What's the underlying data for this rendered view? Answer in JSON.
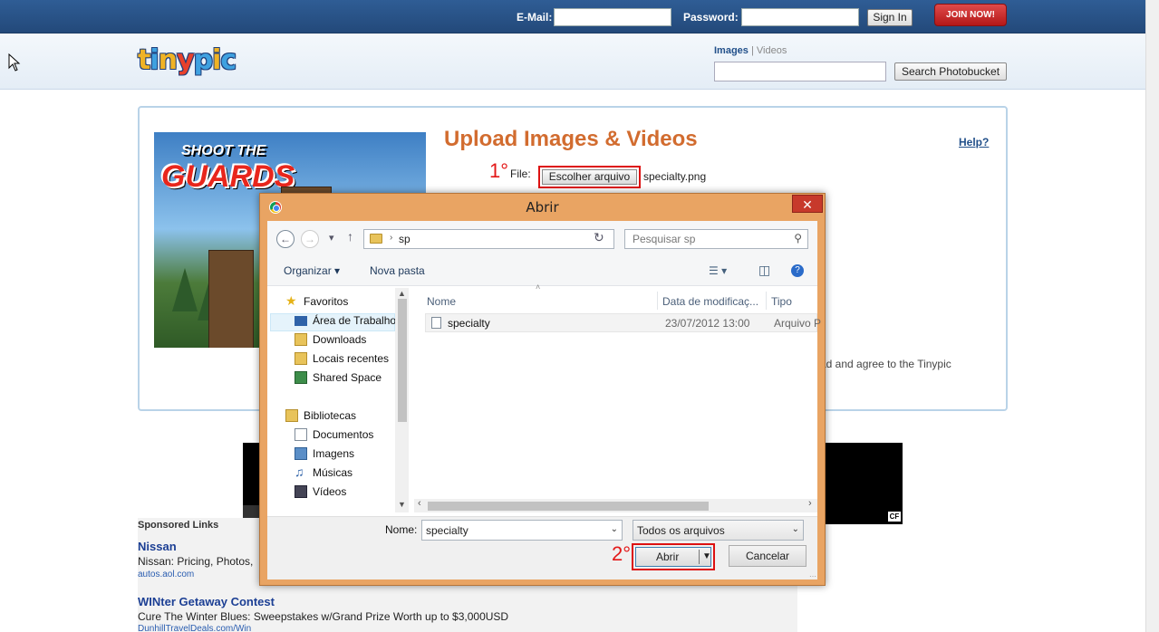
{
  "topbar": {
    "email_label": "E-Mail:",
    "password_label": "Password:",
    "signin_label": "Sign In",
    "join_label": "JOIN NOW!"
  },
  "header": {
    "logo_letters": [
      "t",
      "i",
      "n",
      "y",
      "p",
      "i",
      "c"
    ],
    "logo_colors": [
      "#f0b325",
      "#3fa1e0",
      "#f0b325",
      "#e8412b",
      "#3fa1e0",
      "#f0b325",
      "#3fa1e0"
    ],
    "search_tabs": {
      "images": "Images",
      "separator": "|",
      "videos": "Videos"
    },
    "search_button": "Search Photobucket"
  },
  "game_ad": {
    "line1": "SHOOT THE",
    "line2": "GUARDS"
  },
  "upload": {
    "title": "Upload Images & Videos",
    "help": "Help?",
    "step1": "1°",
    "file_label": "File:",
    "choose_button": "Escolher arquivo",
    "file_name": "specialty.png",
    "terms_partial": "ad and agree to the Tinypic"
  },
  "dialog": {
    "title": "Abrir",
    "close": "✕",
    "path_folder": "sp",
    "search_placeholder": "Pesquisar sp",
    "organize": "Organizar ▾",
    "new_folder": "Nova pasta",
    "nav": {
      "favorites": "Favoritos",
      "desktop": "Área de Trabalho",
      "downloads": "Downloads",
      "recent": "Locais recentes",
      "shared": "Shared Space",
      "libraries": "Bibliotecas",
      "documents": "Documentos",
      "images": "Imagens",
      "music": "Músicas",
      "videos": "Vídeos"
    },
    "columns": {
      "name": "Nome",
      "date": "Data de modificaç...",
      "type": "Tipo"
    },
    "files": [
      {
        "name": "specialty",
        "date": "23/07/2012 13:00",
        "type": "Arquivo P"
      }
    ],
    "name_label": "Nome:",
    "name_value": "specialty",
    "type_filter": "Todos os arquivos",
    "step2": "2°",
    "open_button": "Abrir",
    "cancel_button": "Cancelar"
  },
  "sponsored": {
    "title": "Sponsored Links",
    "ads": [
      {
        "title": "Nissan",
        "desc": "Nissan: Pricing, Photos,",
        "url": "autos.aol.com"
      },
      {
        "title": "WINter Getaway Contest",
        "desc": "Cure The Winter Blues: Sweepstakes w/Grand Prize Worth up to $3,000USD",
        "url": "DunhillTravelDeals.com/Win"
      }
    ]
  },
  "video": {
    "badge": "CF"
  }
}
